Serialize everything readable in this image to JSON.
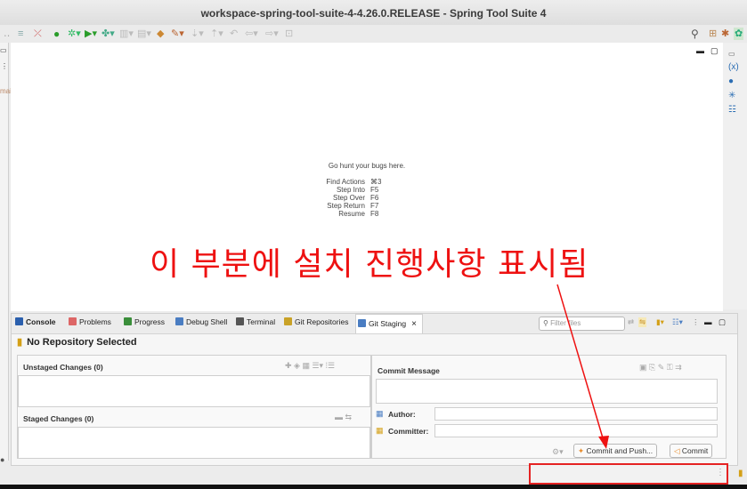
{
  "window": {
    "title": "workspace-spring-tool-suite-4-4.26.0.RELEASE - Spring Tool Suite 4"
  },
  "left_panel": {
    "partial_text": "mai"
  },
  "editor": {
    "hint": "Go hunt your bugs here.",
    "shortcuts": [
      {
        "name": "Find Actions",
        "key": "⌘3"
      },
      {
        "name": "Step Into",
        "key": "F5"
      },
      {
        "name": "Step Over",
        "key": "F6"
      },
      {
        "name": "Step Return",
        "key": "F7"
      },
      {
        "name": "Resume",
        "key": "F8"
      }
    ]
  },
  "annotation": {
    "text": "이 부분에 설치 진행사항 표시됨",
    "color": "#ee1111"
  },
  "bottom_tabs": [
    {
      "label": "Console",
      "icon": "console-icon",
      "color": "#2b5fad",
      "active": false
    },
    {
      "label": "Problems",
      "icon": "problems-icon",
      "color": "#d66",
      "active": false
    },
    {
      "label": "Progress",
      "icon": "progress-icon",
      "color": "#3a8e3a",
      "active": false
    },
    {
      "label": "Debug Shell",
      "icon": "debug-shell-icon",
      "color": "#4a7dc2",
      "active": false
    },
    {
      "label": "Terminal",
      "icon": "terminal-icon",
      "color": "#555",
      "active": false
    },
    {
      "label": "Git Repositories",
      "icon": "git-repositories-icon",
      "color": "#c9a227",
      "active": false
    },
    {
      "label": "Git Staging",
      "icon": "git-staging-icon",
      "color": "#4a7dc2",
      "active": true
    }
  ],
  "git_staging": {
    "filter_placeholder": "Filter files",
    "repository_title": "No Repository Selected",
    "unstaged_label": "Unstaged Changes (0)",
    "staged_label": "Staged Changes (0)",
    "commit_message_label": "Commit Message",
    "author_label": "Author:",
    "committer_label": "Committer:",
    "commit_and_push_label": "Commit and Push...",
    "commit_label": "Commit"
  },
  "colors": {
    "highlight": "#e52222",
    "accent": "#2a6db3"
  }
}
